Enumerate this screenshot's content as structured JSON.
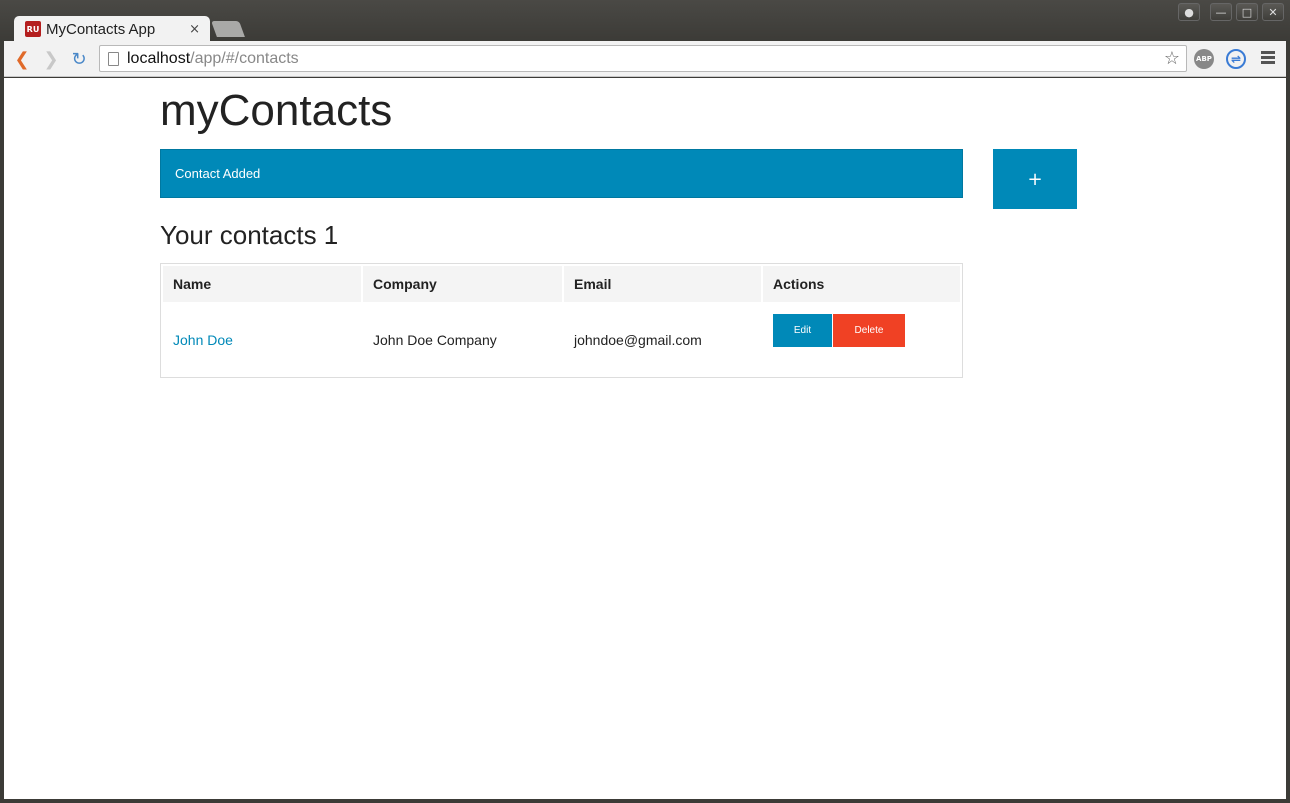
{
  "browser": {
    "tab_title": "MyContacts App",
    "tab_favicon_text": "RU",
    "tab_close": "×",
    "url_host": "localhost",
    "url_path": "/app/#/contacts",
    "ext_abp": "ABP"
  },
  "app": {
    "title": "myContacts",
    "alert_message": "Contact Added",
    "add_button_label": "+",
    "section_title": "Your contacts 1"
  },
  "table": {
    "headers": [
      "Name",
      "Company",
      "Email",
      "Actions"
    ],
    "rows": [
      {
        "name": "John Doe",
        "company": "John Doe Company",
        "email": "johndoe@gmail.com",
        "edit_label": "Edit",
        "delete_label": "Delete"
      }
    ]
  },
  "colors": {
    "primary": "#0089b8",
    "alert": "#f04124"
  }
}
